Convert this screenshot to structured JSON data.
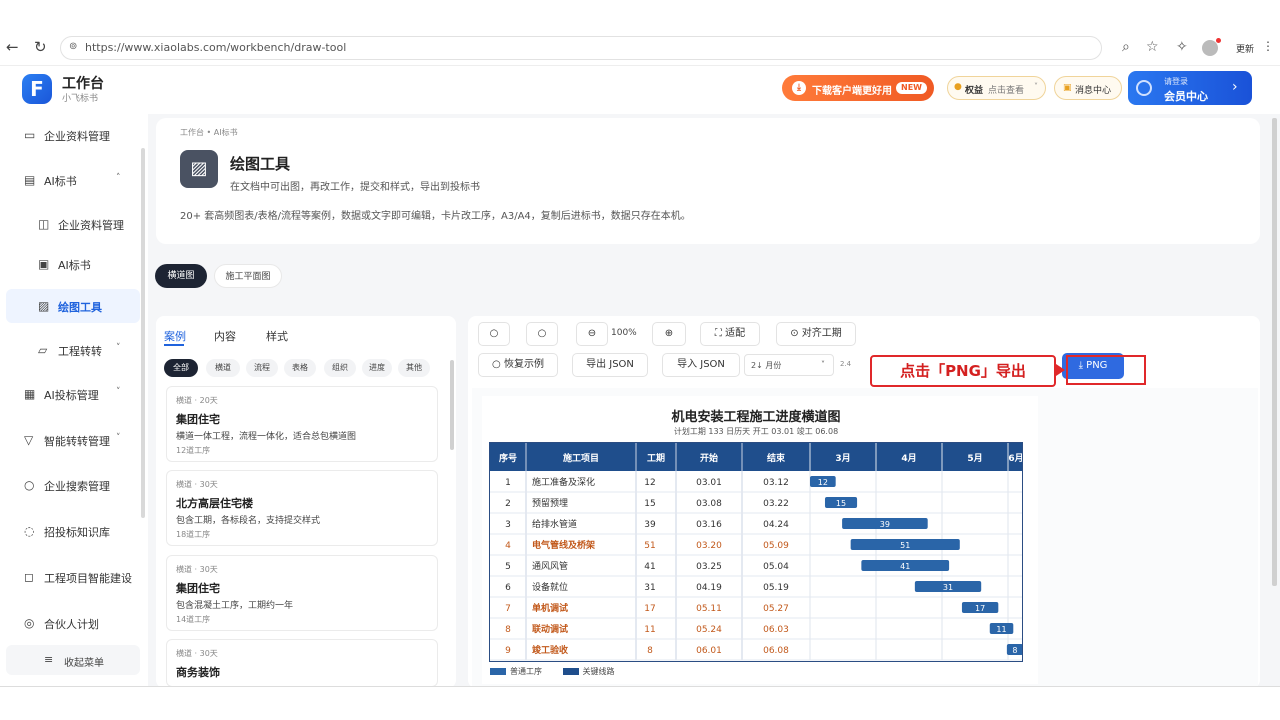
{
  "browser": {
    "url": "https://www.xiaolabs.com/workbench/draw-tool",
    "profile_label": "更新"
  },
  "app": {
    "logo_letter": "F",
    "title": "工作台",
    "subtitle": "小飞标书"
  },
  "header": {
    "promo_label": "下载客户端更好用",
    "promo_badge": "NEW",
    "plan_label": "权益",
    "plan_value": "点击查看",
    "message_label": "消息中心",
    "user_top": "请登录",
    "user_name": "会员中心"
  },
  "sidebar": {
    "items": [
      {
        "label": "企业资料管理",
        "icon": "▭"
      },
      {
        "label": "AI标书",
        "icon": "▤",
        "arrow": "˄"
      },
      {
        "label": "企业资料管理",
        "icon": "◫"
      },
      {
        "label": "AI标书",
        "icon": "▣"
      },
      {
        "label": "绘图工具",
        "icon": "▨"
      },
      {
        "label": "工程转转",
        "icon": "▱",
        "arrow": "˅"
      },
      {
        "label": "AI投标管理",
        "icon": "▦",
        "arrow": "˅"
      },
      {
        "label": "智能转转管理",
        "icon": "▽",
        "arrow": "˅"
      },
      {
        "label": "企业搜索管理",
        "icon": "○"
      },
      {
        "label": "招投标知识库",
        "icon": "◌"
      },
      {
        "label": "工程项目智能建设",
        "icon": "◻"
      },
      {
        "label": "合伙人计划",
        "icon": "◎"
      }
    ],
    "footer": "收起菜单"
  },
  "page": {
    "breadcrumb": "工作台 • AI标书",
    "title": "绘图工具",
    "subtitle": "在文档中可出图，再改工作，提交和样式，导出到投标书",
    "description": "20+ 套高频图表/表格/流程等案例，数据或文字即可编辑，卡片改工序，A3/A4，复制后进标书，数据只存在本机。"
  },
  "mode_tabs": {
    "templates": "横道图",
    "guide": "施工平面图"
  },
  "left_panel": {
    "tabs": [
      "案例",
      "内容",
      "样式"
    ],
    "chips": [
      "全部",
      "横道",
      "流程",
      "表格",
      "组织",
      "进度",
      "其他"
    ],
    "cards": [
      {
        "tag": "横道 · 20天",
        "title": "集团住宅",
        "desc": "横道一体工程，流程一体化，适合总包横道图",
        "meta": "12道工序"
      },
      {
        "tag": "横道 · 30天",
        "title": "北方高层住宅楼",
        "desc": "包含工期，各标段名，支持提交样式",
        "meta": "18道工序"
      },
      {
        "tag": "横道 · 30天",
        "title": "集团住宅",
        "desc": "包含混凝土工序，工期约一年",
        "meta": "14道工序"
      },
      {
        "tag": "横道 · 30天",
        "title": "商务装饰",
        "desc": "",
        "meta": ""
      }
    ]
  },
  "toolbar": {
    "btn_undo": "○",
    "btn_redo": "○",
    "btn_zoom_out": "⊖",
    "zoom_level": "100%",
    "btn_zoom_in": "⊕",
    "btn_fit": "⛶ 适配",
    "btn_align": "⊙ 对齐工期",
    "btn_reset": "○ 恢复示例",
    "btn_export_json": "导出 JSON",
    "btn_import_json": "导入 JSON",
    "year_select": "2↓ 月份",
    "extra_label": "2.4",
    "btn_png": "⤓ PNG"
  },
  "callout": "点击「PNG」导出",
  "gantt": {
    "title": "机电安装工程施工进度横道图",
    "subtitle": "计划工期 133 日历天 开工 03.01 竣工 06.08",
    "headers": [
      "序号",
      "施工项目",
      "工期",
      "开始",
      "结束",
      "3月",
      "4月",
      "5月",
      "6月"
    ],
    "rows": [
      {
        "no": "1",
        "name": "施工准备及深化",
        "dur": 12,
        "start": "03.01",
        "end": "03.12",
        "hl": false
      },
      {
        "no": "2",
        "name": "预留预埋",
        "dur": 15,
        "start": "03.08",
        "end": "03.22",
        "hl": false
      },
      {
        "no": "3",
        "name": "给排水管道",
        "dur": 39,
        "start": "03.16",
        "end": "04.24",
        "hl": false
      },
      {
        "no": "4",
        "name": "电气管线及桥架",
        "dur": 51,
        "start": "03.20",
        "end": "05.09",
        "hl": true
      },
      {
        "no": "5",
        "name": "通风风管",
        "dur": 41,
        "start": "03.25",
        "end": "05.04",
        "hl": false
      },
      {
        "no": "6",
        "name": "设备就位",
        "dur": 31,
        "start": "04.19",
        "end": "05.19",
        "hl": false
      },
      {
        "no": "7",
        "name": "单机调试",
        "dur": 17,
        "start": "05.11",
        "end": "05.27",
        "hl": true
      },
      {
        "no": "8",
        "name": "联动调试",
        "dur": 11,
        "start": "05.24",
        "end": "06.03",
        "hl": true
      },
      {
        "no": "9",
        "name": "竣工验收",
        "dur": 8,
        "start": "06.01",
        "end": "06.08",
        "hl": true
      }
    ],
    "legend": [
      "普通工序",
      "关键线路"
    ],
    "colors": {
      "header": "#1f4e8c",
      "bar": "#2a65a8",
      "highlight_text": "#c2591b"
    }
  }
}
